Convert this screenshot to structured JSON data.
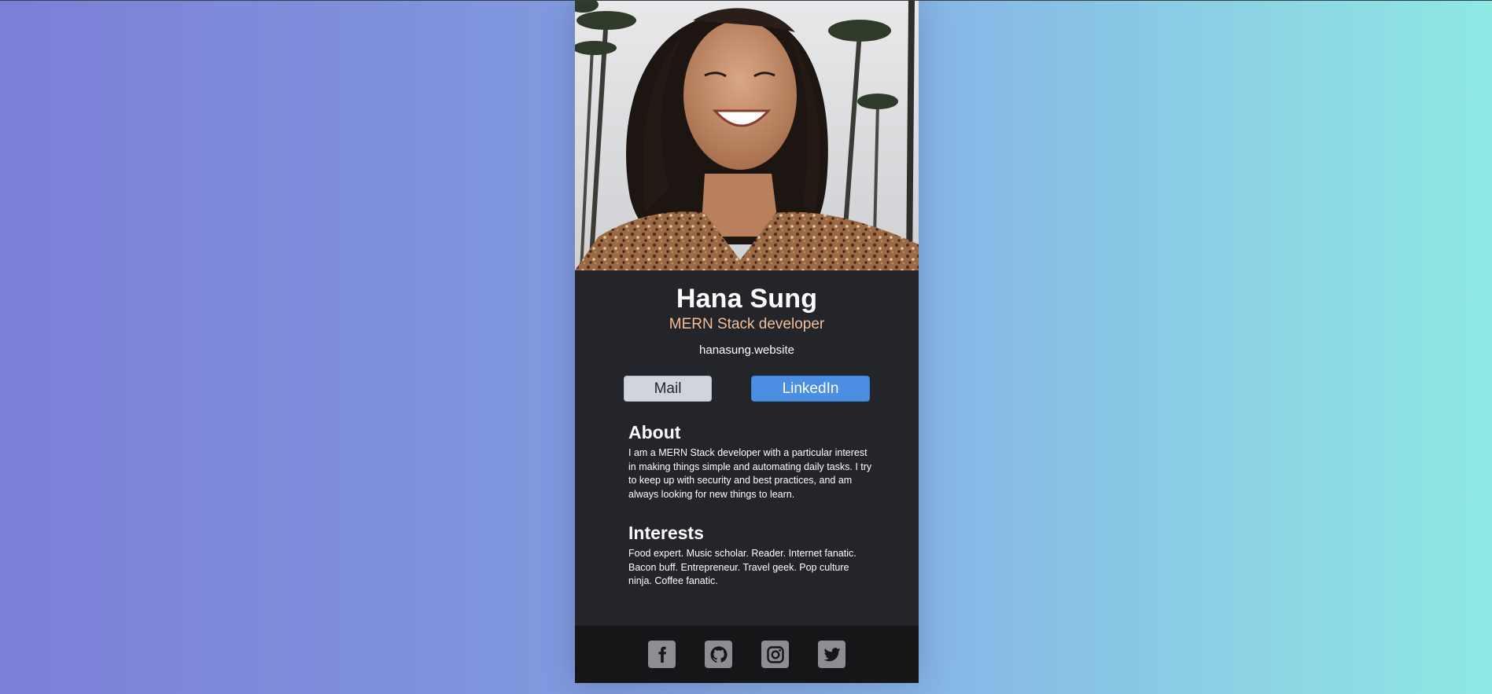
{
  "profile": {
    "name": "Hana Sung",
    "role": "MERN Stack developer",
    "website": "hanasung.website",
    "photo_icon": "profile-photo"
  },
  "buttons": {
    "mail_label": "Mail",
    "linkedin_label": "LinkedIn"
  },
  "about": {
    "heading": "About",
    "text": "I am a MERN Stack developer with a particular interest in making things simple and automating daily tasks. I try to keep up with security and best practices, and am always looking for new things to learn."
  },
  "interests": {
    "heading": "Interests",
    "text": "Food expert. Music scholar. Reader. Internet fanatic. Bacon buff. Entrepreneur. Travel geek. Pop culture ninja. Coffee fanatic."
  },
  "footer": {
    "icons": [
      "facebook-icon",
      "github-icon",
      "instagram-icon",
      "twitter-icon"
    ]
  },
  "colors": {
    "background_gradient_start": "#7b7fd6",
    "background_gradient_end": "#8fe9e3",
    "card": "#23252b",
    "footer": "#161618",
    "role_accent": "#f3bf99",
    "linkedin_button": "#4a8fe2",
    "mail_button": "#d1d4da",
    "social_icon_bg": "#8c8e94"
  }
}
